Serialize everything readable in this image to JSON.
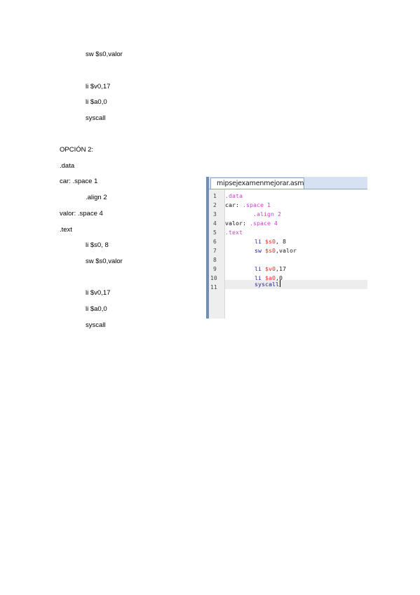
{
  "document": {
    "top_lines": [
      {
        "text": "sw $s0,valor"
      },
      {
        "text": "li $v0,17"
      },
      {
        "text": "li $a0,0"
      },
      {
        "text": "syscall"
      }
    ],
    "heading": "OPCIÓN 2:",
    "option2_lines": [
      {
        "text": ".data"
      },
      {
        "text": "car: .space 1"
      },
      {
        "text": ".align 2"
      },
      {
        "text": "valor: .space 4"
      },
      {
        "text": ".text"
      },
      {
        "text": "li $s0, 8"
      },
      {
        "text": "sw $s0,valor"
      },
      {
        "text": "li $v0,17"
      },
      {
        "text": "li $a0,0"
      },
      {
        "text": "syscall"
      }
    ]
  },
  "editor": {
    "tab_title": "mipsejexamenmejorar.asm",
    "line_numbers": [
      "1",
      "2",
      "3",
      "4",
      "5",
      "6",
      "7",
      "8",
      "9",
      "10",
      "11"
    ],
    "code_lines": [
      {
        "t1": ".data",
        "t2": "",
        "t3": ""
      },
      {
        "t1": "car: ",
        "t2": ".space 1",
        "t3": ""
      },
      {
        "t1": "",
        "t2": ".align 2",
        "t3": ""
      },
      {
        "t1": "valor: ",
        "t2": ".space 4",
        "t3": ""
      },
      {
        "t1": ".text",
        "t2": "",
        "t3": ""
      },
      {
        "t1": "li ",
        "t2": "$s0",
        "t3": ", 8"
      },
      {
        "t1": "sw ",
        "t2": "$s0",
        "t3": ",valor"
      },
      {
        "t1": "",
        "t2": "",
        "t3": ""
      },
      {
        "t1": "li ",
        "t2": "$v0",
        "t3": ",17"
      },
      {
        "t1": "li ",
        "t2": "$a0",
        "t3": ",0"
      },
      {
        "t1": "syscall",
        "t2": "",
        "t3": ""
      }
    ]
  },
  "colors": {
    "directive": "#d23cd0",
    "instruction": "#1f22a8",
    "register": "#e0302a",
    "editor_border": "#6f8fb6"
  }
}
